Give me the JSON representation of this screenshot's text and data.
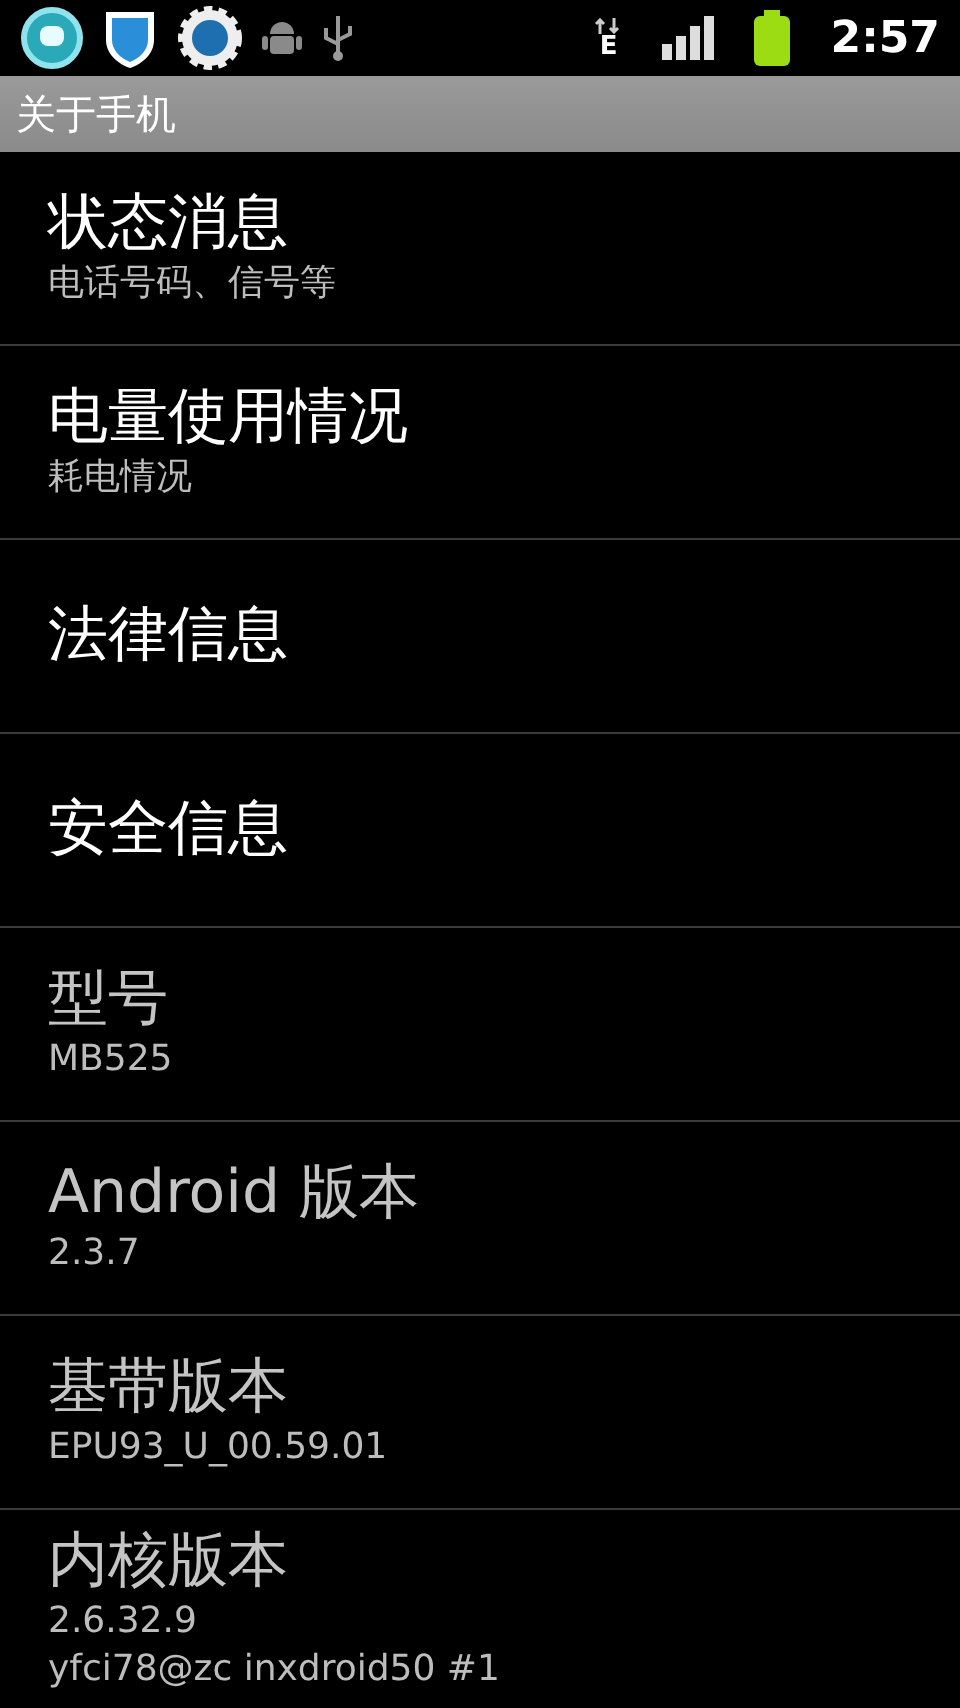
{
  "status_bar": {
    "time": "2:57",
    "network_type": "E"
  },
  "title_bar": {
    "title": "关于手机"
  },
  "items": [
    {
      "title": "状态消息",
      "summary": [
        "电话号码、信号等"
      ],
      "disabled": false
    },
    {
      "title": "电量使用情况",
      "summary": [
        "耗电情况"
      ],
      "disabled": false
    },
    {
      "title": "法律信息",
      "disabled": false
    },
    {
      "title": "安全信息",
      "disabled": false
    },
    {
      "title": "型号",
      "summary": [
        "MB525"
      ],
      "disabled": true
    },
    {
      "title": "Android 版本",
      "summary": [
        "2.3.7"
      ],
      "disabled": true
    },
    {
      "title": "基带版本",
      "summary": [
        "EPU93_U_00.59.01"
      ],
      "disabled": true
    },
    {
      "title": "内核版本",
      "summary": [
        "2.6.32.9",
        "yfci78@zc inxdroid50 #1"
      ],
      "disabled": true
    }
  ]
}
